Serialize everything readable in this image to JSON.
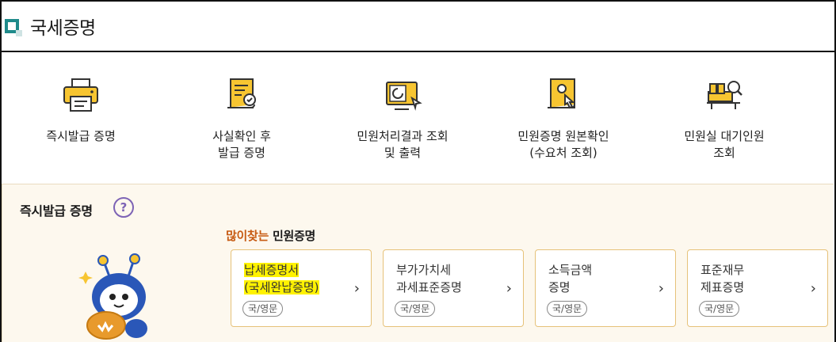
{
  "header": {
    "title": "국세증명"
  },
  "services": [
    {
      "label": "즉시발급 증명",
      "icon": "printer-icon"
    },
    {
      "label": "사실확인 후\n발급 증명",
      "icon": "certificate-scroll-icon"
    },
    {
      "label": "민원처리결과 조회\n및 출력",
      "icon": "monitor-result-icon"
    },
    {
      "label": "민원증명 원본확인\n(수요처 조회)",
      "icon": "document-verify-icon"
    },
    {
      "label": "민원실 대기인원\n조회",
      "icon": "waiting-room-icon"
    }
  ],
  "panel": {
    "title": "즉시발급 증명",
    "help_label": "?",
    "popular_highlight": "많이찾는",
    "popular_rest": " 민원증명"
  },
  "cards": [
    {
      "line1": "납세증명서",
      "line2": "(국세완납증명)",
      "badge": "국/영문",
      "highlighted": true
    },
    {
      "line1": "부가가치세",
      "line2": "과세표준증명",
      "badge": "국/영문",
      "highlighted": false
    },
    {
      "line1": "소득금액",
      "line2": "증명",
      "badge": "국/영문",
      "highlighted": false
    },
    {
      "line1": "표준재무",
      "line2": "제표증명",
      "badge": "국/영문",
      "highlighted": false
    }
  ],
  "colors": {
    "accent_yellow": "#f7c531",
    "header_bullet": "#1f8a8a",
    "panel_bg": "#fdf8ee",
    "popular_orange": "#c75a12",
    "help_purple": "#7d63b5"
  }
}
